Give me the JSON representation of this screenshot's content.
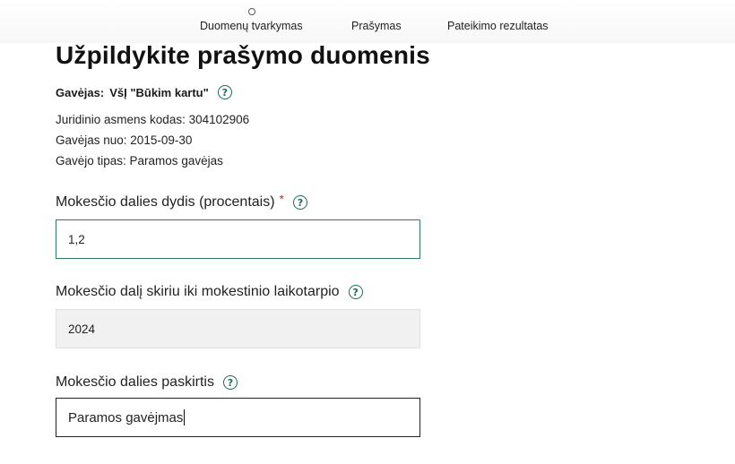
{
  "stepper": {
    "steps": [
      "Duomenų tvarkymas",
      "Prašymas",
      "Pateikimo rezultatas"
    ]
  },
  "page": {
    "title": "Užpildykite prašymo duomenis"
  },
  "recipient": {
    "label": "Gavėjas:",
    "name": "VšĮ \"Būkim kartu\"",
    "code": "Juridinio asmens kodas: 304102906",
    "since": "Gavėjas nuo: 2015-09-30",
    "type": "Gavėjo tipas: Paramos gavėjas"
  },
  "form": {
    "percent": {
      "label": "Mokesčio dalies dydis (procentais)",
      "required_mark": "*",
      "value": "1,2"
    },
    "until_period": {
      "label": "Mokesčio dalį skiriu iki mokestinio laikotarpio",
      "value": "2024"
    },
    "purpose": {
      "label": "Mokesčio dalies paskirtis",
      "value": "Paramos gavėjmas"
    }
  },
  "icons": {
    "help": "?"
  },
  "colors": {
    "accent": "#1c6b57",
    "required": "#c4302b"
  }
}
